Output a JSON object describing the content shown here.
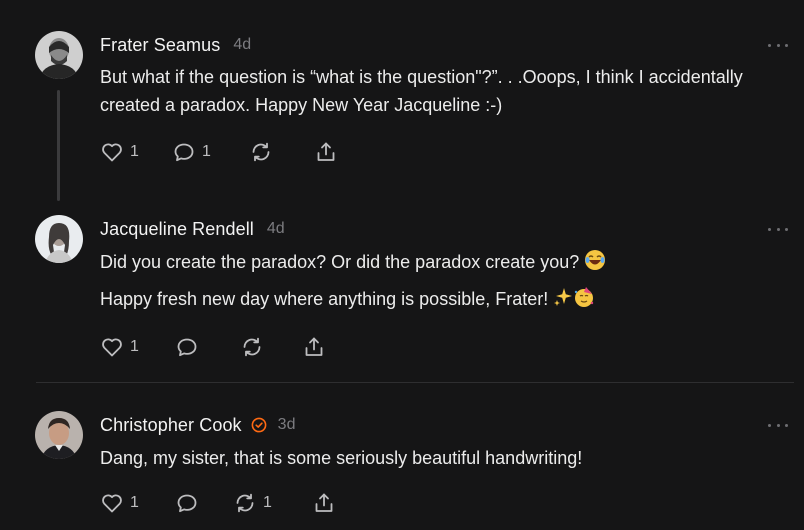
{
  "theme": {
    "background": "#151516",
    "text": "#f2f2f2",
    "muted": "#7c7c80",
    "icon": "#bdbdbf",
    "verified": "#ff6a13"
  },
  "comments": [
    {
      "author": "Frater Seamus",
      "time": "4d",
      "verified": false,
      "avatar_icon": "user-avatar-icon",
      "paragraphs": [
        "But what if the question is “what is the question\"?”. . .Ooops, I think I accidentally created a paradox. Happy New Year Jacqueline :-)"
      ],
      "likes": "1",
      "replies": "1",
      "restacks": ""
    },
    {
      "author": "Jacqueline Rendell",
      "time": "4d",
      "verified": false,
      "avatar_icon": "user-avatar-icon",
      "paragraphs": [
        "Did you create the paradox? Or did the paradox create you?",
        "Happy fresh new day where anything is possible, Frater!"
      ],
      "emojis": [
        "laughing-tears-emoji",
        "sparkles-emoji",
        "party-face-emoji"
      ],
      "likes": "1",
      "replies": "",
      "restacks": ""
    },
    {
      "author": "Christopher Cook",
      "time": "3d",
      "verified": true,
      "avatar_icon": "user-avatar-icon",
      "paragraphs": [
        "Dang, my sister, that is some seriously beautiful handwriting!"
      ],
      "likes": "1",
      "replies": "",
      "restacks": "1"
    }
  ]
}
